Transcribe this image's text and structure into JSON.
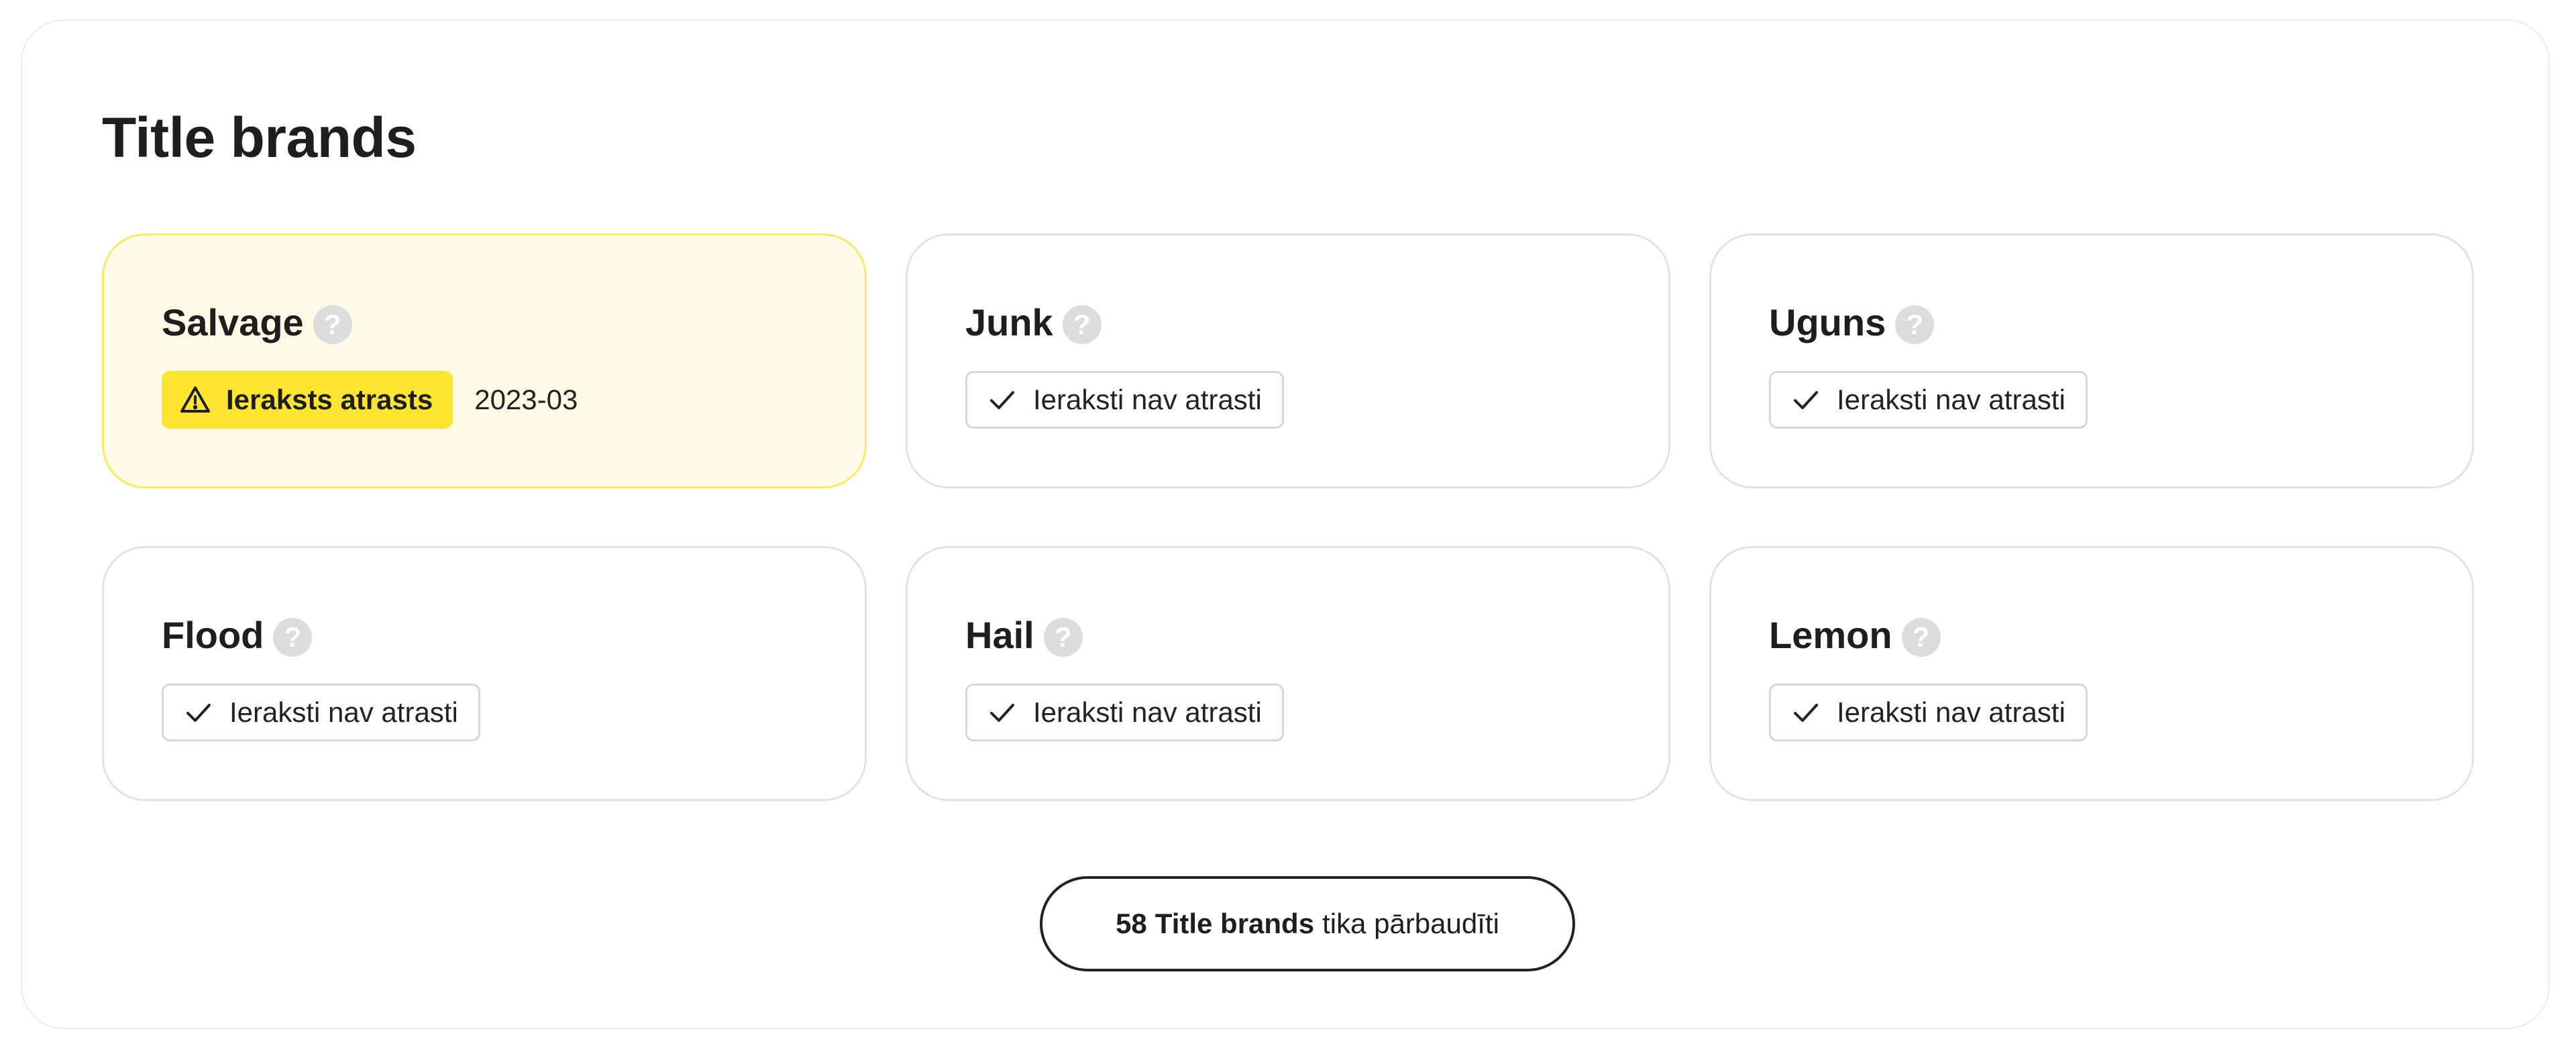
{
  "title": "Title brands",
  "cards": [
    {
      "name": "Salvage",
      "help": "?",
      "status": "Ieraksts atrasts",
      "date": "2023-03"
    },
    {
      "name": "Junk",
      "help": "?",
      "status": "Ieraksti nav atrasti"
    },
    {
      "name": "Uguns",
      "help": "?",
      "status": "Ieraksti nav atrasti"
    },
    {
      "name": "Flood",
      "help": "?",
      "status": "Ieraksti nav atrasti"
    },
    {
      "name": "Hail",
      "help": "?",
      "status": "Ieraksti nav atrasti"
    },
    {
      "name": "Lemon",
      "help": "?",
      "status": "Ieraksti nav atrasti"
    }
  ],
  "summary": {
    "count": "58",
    "label": "Title brands",
    "suffix": "tika pārbaudīti"
  },
  "icons": {
    "alert": "warning-triangle-icon",
    "ok": "checkmark-icon",
    "help": "question-mark-icon"
  },
  "colors": {
    "alert_badge": "#fde532",
    "alert_card_bg": "#fffbe6",
    "alert_card_border": "#fbe869",
    "card_border": "#e2e2e2",
    "help_circle": "#dcdcdc",
    "text": "#1e1e1e"
  }
}
